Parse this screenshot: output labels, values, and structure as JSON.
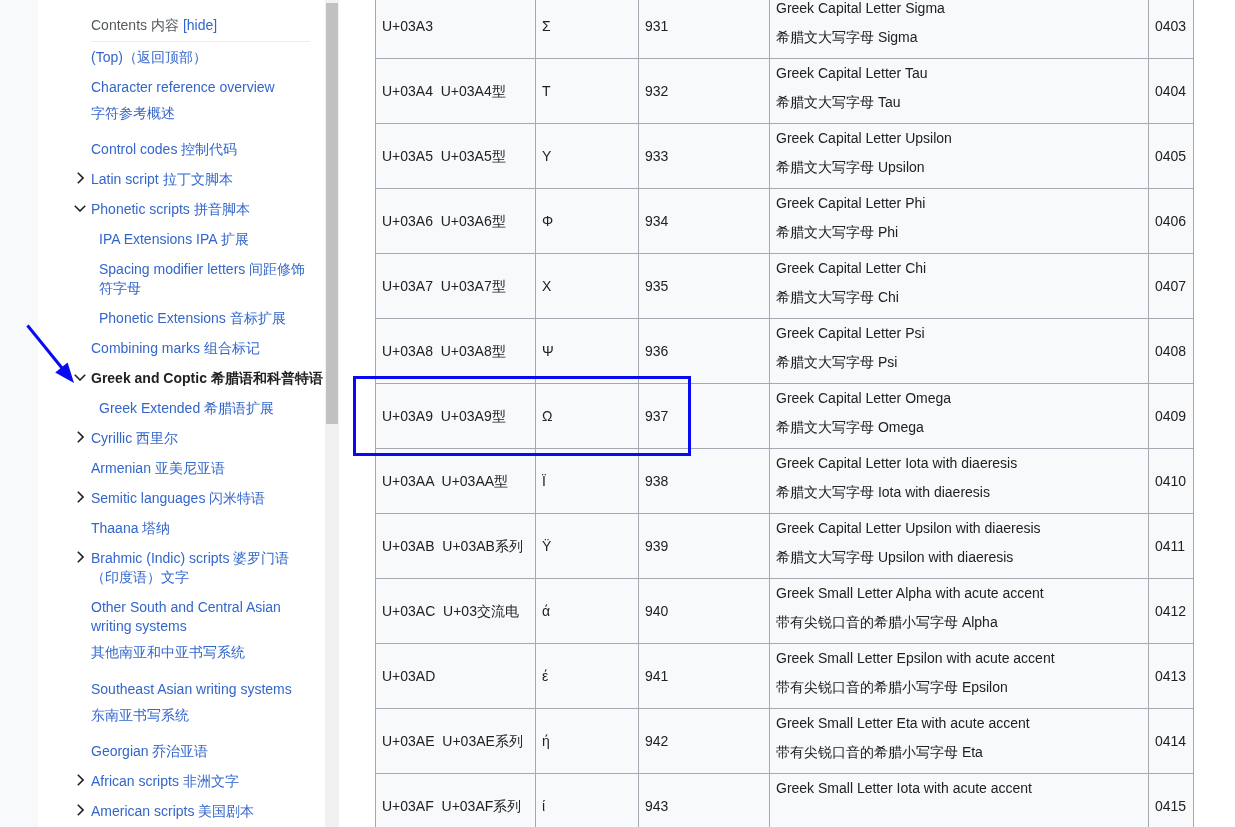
{
  "toc": {
    "title": "Contents 内容",
    "hide_label": "[hide]",
    "items": [
      {
        "label": "(Top)（返回顶部）",
        "selected": false
      },
      {
        "label": "Character reference overview",
        "sub_label": "字符参考概述",
        "selected": false
      },
      {
        "label": "Control codes 控制代码",
        "selected": false
      },
      {
        "label": "Latin script 拉丁文脚本",
        "expanded": false,
        "selected": false
      },
      {
        "label": "Phonetic scripts 拼音脚本",
        "expanded": true,
        "selected": false,
        "children": [
          {
            "label": "IPA Extensions IPA 扩展",
            "selected": false
          },
          {
            "label": "Spacing modifier letters 间距修饰符字母",
            "selected": false
          },
          {
            "label": "Phonetic Extensions 音标扩展",
            "selected": false
          }
        ]
      },
      {
        "label": "Combining marks 组合标记",
        "selected": false
      },
      {
        "label": "Greek and Coptic 希腊语和科普特语",
        "expanded": true,
        "selected": true,
        "children": [
          {
            "label": "Greek Extended 希腊语扩展",
            "selected": false
          }
        ]
      },
      {
        "label": "Cyrillic 西里尔",
        "expanded": false,
        "selected": false
      },
      {
        "label": "Armenian 亚美尼亚语",
        "selected": false
      },
      {
        "label": "Semitic languages 闪米特语",
        "expanded": false,
        "selected": false
      },
      {
        "label": "Thaana 塔纳",
        "selected": false
      },
      {
        "label": "Brahmic (Indic) scripts 婆罗门语（印度语）文字",
        "expanded": false,
        "selected": false
      },
      {
        "label": "Other South and Central Asian writing systems",
        "sub_label": "其他南亚和中亚书写系统",
        "selected": false
      },
      {
        "label": "Southeast Asian writing systems",
        "sub_label": "东南亚书写系统",
        "selected": false
      },
      {
        "label": "Georgian 乔治亚语",
        "selected": false
      },
      {
        "label": "African scripts 非洲文字",
        "expanded": false,
        "selected": false
      },
      {
        "label": "American scripts 美国剧本",
        "expanded": false,
        "selected": false
      }
    ]
  },
  "table": {
    "rows": [
      {
        "column_1": "U+03A3",
        "column_2": "Σ",
        "column_3": "931",
        "column_4": [
          "Greek Capital Letter Sigma",
          "希腊文大写字母 Sigma"
        ],
        "column_5": "0403",
        "highlighted": false
      },
      {
        "column_1": "U+03A4  U+03A4型",
        "column_2": "Τ",
        "column_3": "932",
        "column_4": [
          "Greek Capital Letter Tau",
          "希腊文大写字母 Tau"
        ],
        "column_5": "0404",
        "highlighted": false
      },
      {
        "column_1": "U+03A5  U+03A5型",
        "column_2": "Υ",
        "column_3": "933",
        "column_4": [
          "Greek Capital Letter Upsilon",
          "希腊文大写字母 Upsilon"
        ],
        "column_5": "0405",
        "highlighted": false
      },
      {
        "column_1": "U+03A6  U+03A6型",
        "column_2": "Φ",
        "column_3": "934",
        "column_4": [
          "Greek Capital Letter Phi",
          "希腊文大写字母 Phi"
        ],
        "column_5": "0406",
        "highlighted": false
      },
      {
        "column_1": "U+03A7  U+03A7型",
        "column_2": "Χ",
        "column_3": "935",
        "column_4": [
          "Greek Capital Letter Chi",
          "希腊文大写字母 Chi"
        ],
        "column_5": "0407",
        "highlighted": false
      },
      {
        "column_1": "U+03A8  U+03A8型",
        "column_2": "Ψ",
        "column_3": "936",
        "column_4": [
          "Greek Capital Letter Psi",
          "希腊文大写字母 Psi"
        ],
        "column_5": "0408",
        "highlighted": false
      },
      {
        "column_1": "U+03A9  U+03A9型",
        "column_2": "Ω",
        "column_3": "937",
        "column_4": [
          "Greek Capital Letter Omega",
          "希腊文大写字母 Omega"
        ],
        "column_5": "0409",
        "highlighted": true
      },
      {
        "column_1": "U+03AA  U+03AA型",
        "column_2": "Ϊ",
        "column_3": "938",
        "column_4": [
          "Greek Capital Letter Iota with diaeresis",
          "希腊文大写字母 Iota with diaeresis"
        ],
        "column_5": "0410",
        "highlighted": false
      },
      {
        "column_1": "U+03AB  U+03AB系列",
        "column_2": "Ϋ",
        "column_3": "939",
        "column_4": [
          "Greek Capital Letter Upsilon with diaeresis",
          "希腊文大写字母 Upsilon with diaeresis"
        ],
        "column_5": "0411",
        "highlighted": false
      },
      {
        "column_1": "U+03AC  U+03交流电",
        "column_2": "ά",
        "column_3": "940",
        "column_4": [
          "Greek Small Letter Alpha with acute accent",
          "带有尖锐口音的希腊小写字母 Alpha"
        ],
        "column_5": "0412",
        "highlighted": false
      },
      {
        "column_1": "U+03AD",
        "column_2": "έ",
        "column_3": "941",
        "column_4": [
          "Greek Small Letter Epsilon with acute accent",
          "带有尖锐口音的希腊小写字母 Epsilon"
        ],
        "column_5": "0413",
        "highlighted": false
      },
      {
        "column_1": "U+03AE  U+03AE系列",
        "column_2": "ή",
        "column_3": "942",
        "column_4": [
          "Greek Small Letter Eta with acute accent",
          "带有尖锐口音的希腊小写字母 Eta"
        ],
        "column_5": "0414",
        "highlighted": false
      },
      {
        "column_1": "U+03AF  U+03AF系列",
        "column_2": "ί",
        "column_3": "943",
        "column_4": [
          "Greek Small Letter Iota with acute accent"
        ],
        "column_5": "0415",
        "highlighted": false
      }
    ]
  }
}
